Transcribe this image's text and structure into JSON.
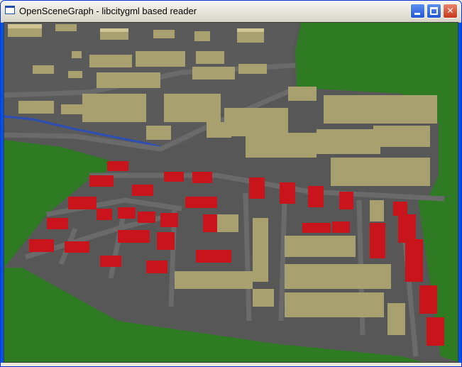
{
  "window": {
    "title": "OpenSceneGraph - libcitygml based reader",
    "buttons": {
      "minimize": "minimize",
      "maximize": "maximize",
      "close": "close"
    }
  },
  "colors": {
    "ground": "#2f7a24",
    "road": "#5c5c5c",
    "wall": "#a8a06e",
    "roof_flat": "#c9c08a",
    "roof_red": "#d11a1a",
    "water": "#2d4fb5"
  },
  "icons": {
    "app": "window-app-icon",
    "minimize": "minimize-icon",
    "maximize": "maximize-icon",
    "close": "close-icon"
  }
}
